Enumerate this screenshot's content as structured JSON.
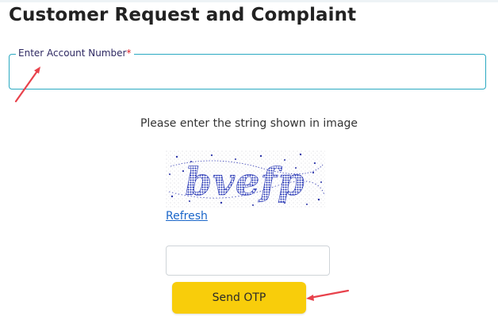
{
  "page": {
    "title": "Customer Request and Complaint"
  },
  "account_field": {
    "label": "Enter Account Number",
    "required_mark": "*",
    "value": "",
    "border_color": "#2aa9c2"
  },
  "captcha": {
    "prompt": "Please enter the string shown in image",
    "image_text": "bvefp",
    "refresh_label": "Refresh",
    "input_value": ""
  },
  "actions": {
    "send_otp_label": "Send OTP",
    "button_color": "#f8cd0b"
  },
  "annotations": {
    "arrow_color": "#e8424c",
    "arrow_icon": "red-pointer-arrow-icon"
  }
}
